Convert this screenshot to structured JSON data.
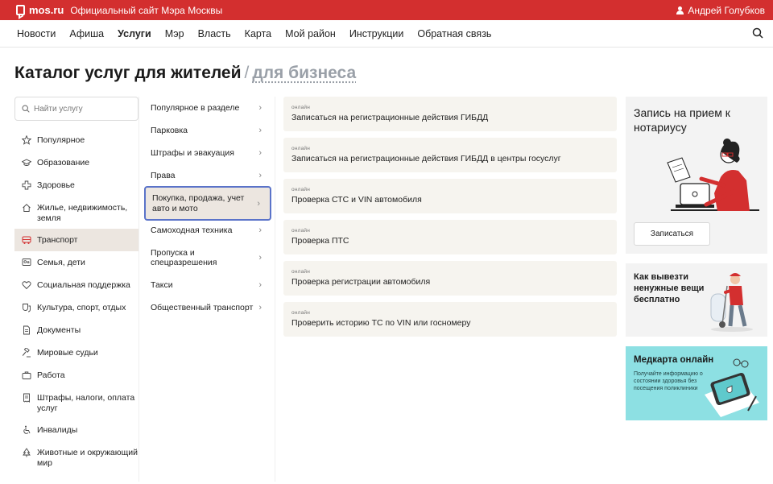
{
  "topbar": {
    "logo": "mos.ru",
    "official": "Официальный сайт Мэра Москвы",
    "user": "Андрей Голубков"
  },
  "nav": {
    "items": [
      "Новости",
      "Афиша",
      "Услуги",
      "Мэр",
      "Власть",
      "Карта",
      "Мой район",
      "Инструкции",
      "Обратная связь"
    ],
    "active": "Услуги"
  },
  "heading": {
    "title": "Каталог услуг для жителей",
    "separator": "/",
    "business_link": "для бизнеса"
  },
  "search": {
    "placeholder": "Найти услугу"
  },
  "categories": [
    {
      "label": "Популярное",
      "icon": "star-icon"
    },
    {
      "label": "Образование",
      "icon": "graduation-cap-icon"
    },
    {
      "label": "Здоровье",
      "icon": "medical-cross-icon"
    },
    {
      "label": "Жилье, недвижимость, земля",
      "icon": "house-icon"
    },
    {
      "label": "Транспорт",
      "icon": "bus-icon",
      "active": true
    },
    {
      "label": "Семья, дети",
      "icon": "family-icon"
    },
    {
      "label": "Социальная поддержка",
      "icon": "heart-icon"
    },
    {
      "label": "Культура, спорт, отдых",
      "icon": "theater-icon"
    },
    {
      "label": "Документы",
      "icon": "document-icon"
    },
    {
      "label": "Мировые судьи",
      "icon": "gavel-icon"
    },
    {
      "label": "Работа",
      "icon": "briefcase-icon"
    },
    {
      "label": "Штрафы, налоги, оплата услуг",
      "icon": "receipt-icon"
    },
    {
      "label": "Инвалиды",
      "icon": "wheelchair-icon"
    },
    {
      "label": "Животные и окружающий мир",
      "icon": "tree-icon"
    }
  ],
  "subcategories": [
    "Популярное в разделе",
    "Парковка",
    "Штрафы и эвакуация",
    "Права",
    "Покупка, продажа, учет авто и мото",
    "Самоходная техника",
    "Пропуска и спецразрешения",
    "Такси",
    "Общественный транспорт"
  ],
  "active_subcategory": "Покупка, продажа, учет авто и мото",
  "chevron": "›",
  "services": [
    {
      "tag": "онлайн",
      "name": "Записаться на регистрационные действия ГИБДД"
    },
    {
      "tag": "онлайн",
      "name": "Записаться на регистрационные действия ГИБДД в центры госуслуг"
    },
    {
      "tag": "онлайн",
      "name": "Проверка СТС и VIN автомобиля"
    },
    {
      "tag": "онлайн",
      "name": "Проверка ПТС"
    },
    {
      "tag": "онлайн",
      "name": "Проверка регистрации автомобиля"
    },
    {
      "tag": "онлайн",
      "name": "Проверить историю ТС по VIN или госномеру"
    }
  ],
  "promo": {
    "notary": {
      "title": "Запись на прием к нотариусу",
      "button": "Записаться"
    },
    "trash": {
      "title": "Как вывезти ненужные вещи бесплатно"
    },
    "medcard": {
      "title": "Медкарта онлайн",
      "desc": "Получайте информацию о состоянии здоровья без посещения поликлиники"
    }
  },
  "colors": {
    "brand": "#d32f2f",
    "active_bg": "#ece6e0",
    "active_border": "#5a73c9",
    "medcard_bg": "#8de0e3"
  }
}
